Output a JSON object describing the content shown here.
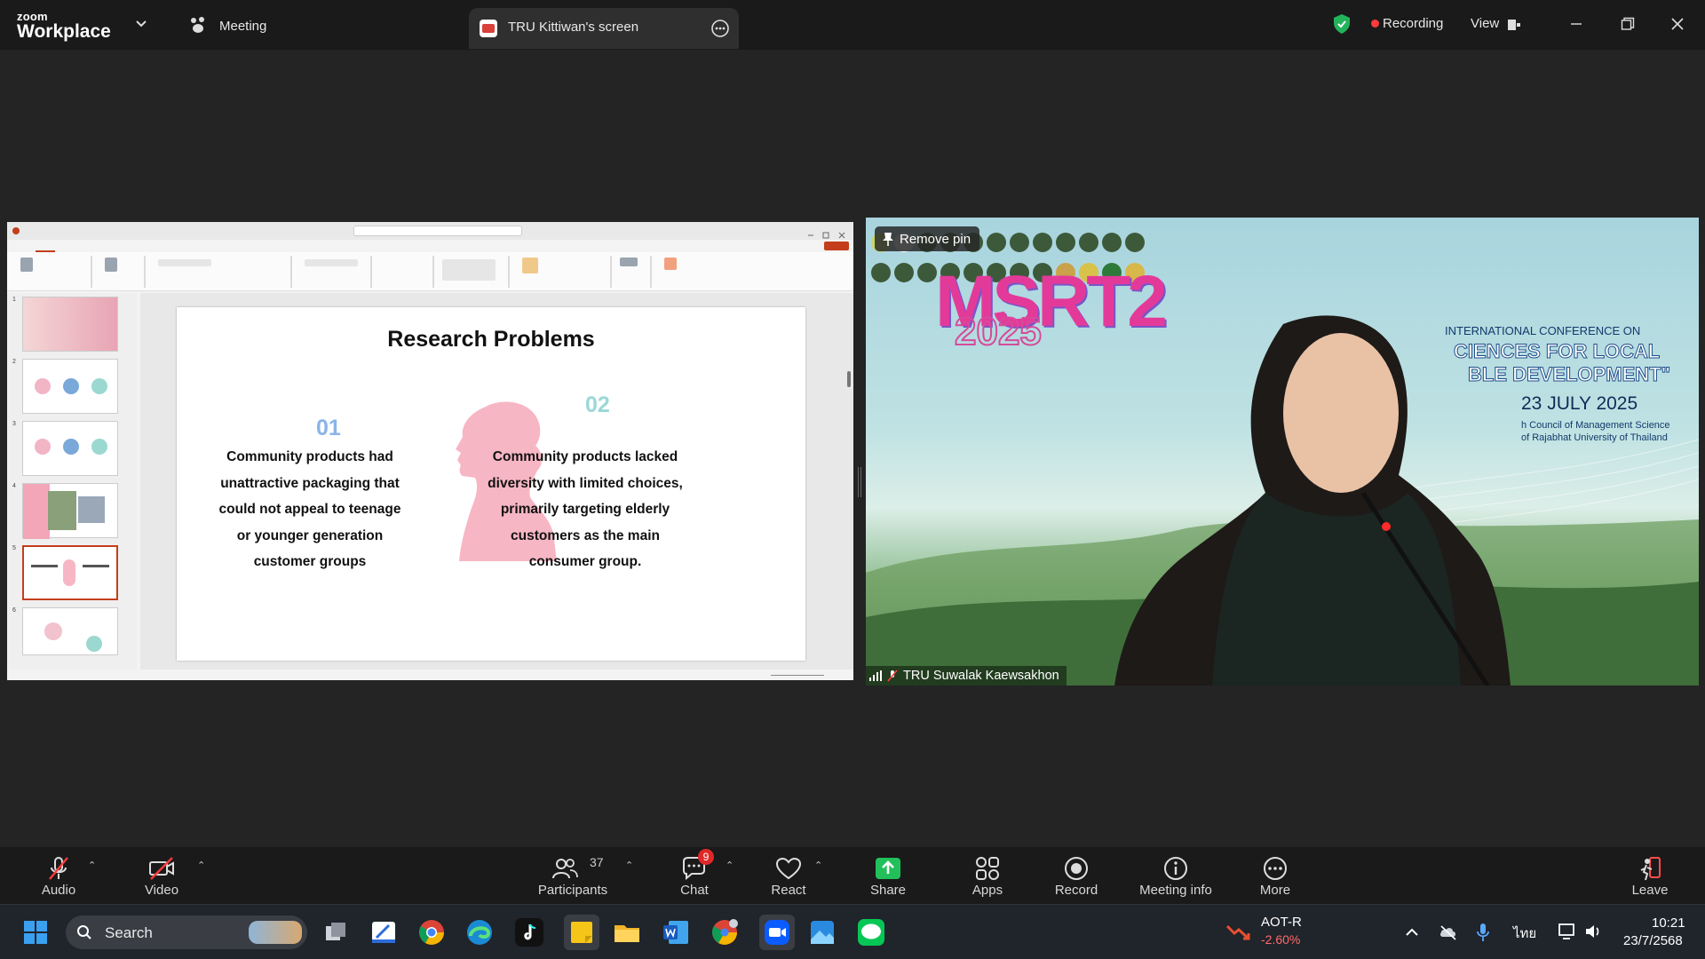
{
  "titlebar": {
    "logo_line1": "zoom",
    "logo_line2": "Workplace",
    "meeting_label": "Meeting",
    "share_tab_label": "TRU Kittiwan's screen",
    "recording_label": "Recording",
    "view_label": "View"
  },
  "slide": {
    "title": "Research Problems",
    "num1": "01",
    "text1": [
      "Community products had",
      "unattractive packaging that",
      "could not appeal to teenage",
      "or younger generation",
      "customer groups"
    ],
    "num2": "02",
    "text2": [
      "Community products lacked",
      "diversity with limited choices,",
      "primarily targeting elderly",
      "customers as the main",
      "consumer group."
    ],
    "num1_color": "#8ab4e8",
    "num2_color": "#9bd8d8",
    "silhouette_color": "#f7b6c4"
  },
  "ppt": {
    "thumb_numbers": [
      "1",
      "2",
      "3",
      "4",
      "5",
      "6"
    ]
  },
  "video": {
    "remove_pin_label": "Remove pin",
    "participant_name": "TRU Suwalak Kaewsakhon",
    "logo_text": "MSRT2",
    "logo_year": "2025",
    "conf_line1": "INTERNATIONAL CONFERENCE ON",
    "conf_line2": "CIENCES FOR LOCAL",
    "conf_line3": "BLE DEVELOPMENT\"",
    "conf_date": "23 JULY 2025",
    "conf_line4": "h Council of Management Science",
    "conf_line5": "of Rajabhat University of Thailand"
  },
  "toolbar": {
    "audio": "Audio",
    "video": "Video",
    "participants": "Participants",
    "participants_count": "37",
    "chat": "Chat",
    "chat_badge": "9",
    "react": "React",
    "share": "Share",
    "apps": "Apps",
    "record": "Record",
    "meeting_info": "Meeting info",
    "more": "More",
    "leave": "Leave"
  },
  "taskbar": {
    "search_label": "Search",
    "stock_name": "AOT-R",
    "stock_change": "-2.60%",
    "lang": "ไทย",
    "time": "10:21",
    "date": "23/7/2568"
  }
}
